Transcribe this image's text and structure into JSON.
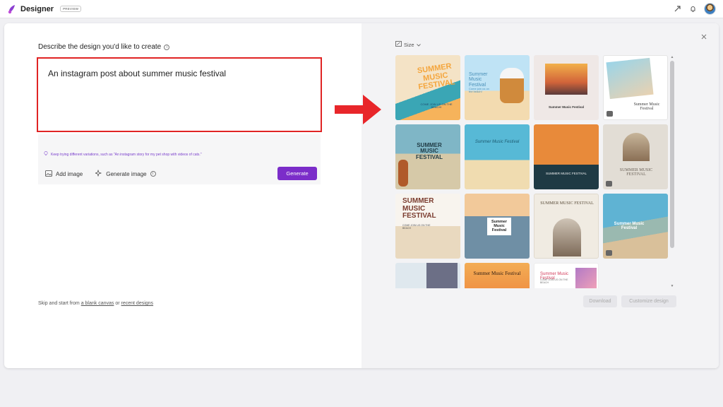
{
  "app": {
    "title": "Designer",
    "badge": "PREVIEW"
  },
  "prompt": {
    "label": "Describe the design you'd like to create",
    "text": "An instagram post about summer music festival",
    "tip": "Keep trying different variations, such as \"An instagram story for my pet shop with videos of cats.\"",
    "add_image": "Add image",
    "generate_image": "Generate image",
    "generate": "Generate"
  },
  "skip": {
    "prefix": "Skip and start from ",
    "blank_canvas": "a blank canvas",
    "or": " or ",
    "recent": "recent designs"
  },
  "gallery": {
    "size_label": "Size",
    "download": "Download",
    "customize": "Customize design",
    "tiles": [
      {
        "title": "SUMMER MUSIC FESTIVAL",
        "subtitle": "COME JOIN US ON THE BEACH!"
      },
      {
        "title": "Summer Music Festival",
        "subtitle": "Come join us on the beach!"
      },
      {
        "title": "Summer Music Festival",
        "subtitle": ""
      },
      {
        "title": "Summer Music Festival",
        "subtitle": ""
      },
      {
        "title": "SUMMER MUSIC FESTIVAL",
        "subtitle": ""
      },
      {
        "title": "Summer Music Festival",
        "subtitle": ""
      },
      {
        "title": "SUMMER MUSIC FESTIVAL",
        "subtitle": ""
      },
      {
        "title": "SUMMER MUSIC FESTIVAL",
        "subtitle": ""
      },
      {
        "title": "SUMMER MUSIC FESTIVAL",
        "subtitle": "COME JOIN US ON THE BEACH"
      },
      {
        "title": "Summer Music Festival",
        "subtitle": ""
      },
      {
        "title": "SUMMER MUSIC FESTIVAL",
        "subtitle": ""
      },
      {
        "title": "Summer Music Festival",
        "subtitle": ""
      },
      {
        "title": "",
        "subtitle": ""
      },
      {
        "title": "Summer Music Festival",
        "subtitle": ""
      },
      {
        "title": "Summer Music Festival",
        "subtitle": "COME JOIN US ON THE BEACH"
      }
    ]
  },
  "colors": {
    "accent": "#7b2dc9",
    "highlight": "#e02424"
  }
}
